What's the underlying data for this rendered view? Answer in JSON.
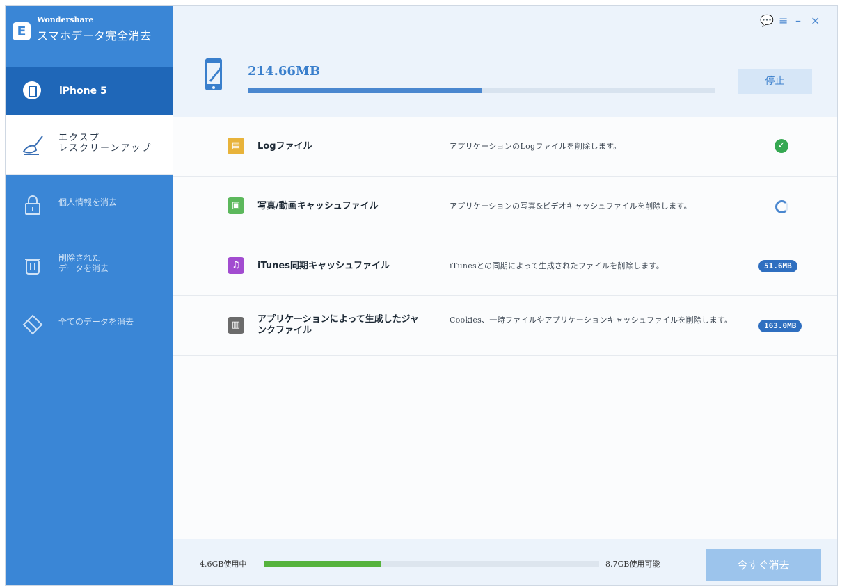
{
  "brand": {
    "company": "Wondershare",
    "title": "スマホデータ完全消去"
  },
  "device": {
    "name": "iPhone 5"
  },
  "sidebar": {
    "items": [
      {
        "label_line1": "エクスプ",
        "label_line2": "レスクリーンアップ",
        "active": true
      },
      {
        "label_line1": "個人情報を消去",
        "label_line2": "",
        "active": false
      },
      {
        "label_line1": "削除された",
        "label_line2": "データを消去",
        "active": false
      },
      {
        "label_line1": "全てのデータを消去",
        "label_line2": "",
        "active": false
      }
    ]
  },
  "window_controls": {
    "chat": "💬",
    "menu": "≡",
    "minimize": "–",
    "close": "×"
  },
  "scan": {
    "size": "214.66MB",
    "progress_fraction": 0.5,
    "stop_label": "停止"
  },
  "files": [
    {
      "name": "Logファイル",
      "description": "アプリケーションのLogファイルを削除します。",
      "status": "done",
      "icon_color": "#e8b33a",
      "icon_name": "log-file-icon",
      "glyph": "▤"
    },
    {
      "name": "写真/動画キャッシュファイル",
      "description": "アプリケーションの写真&ビデオキャッシュファイルを削除します。",
      "status": "loading",
      "icon_color": "#5cb85c",
      "icon_name": "photo-icon",
      "glyph": "▣"
    },
    {
      "name": "iTunes同期キャッシュファイル",
      "description": "iTunesとの同期によって生成されたファイルを削除します。",
      "status": "size",
      "size": "51.6MB",
      "icon_color": "#a24cd0",
      "icon_name": "music-icon",
      "glyph": "♫"
    },
    {
      "name": "アプリケーションによって生成したジャンクファイル",
      "description": "Cookies、一時ファイルやアプリケーションキャッシュファイルを削除します。",
      "status": "size",
      "size": "163.0MB",
      "icon_color": "#6b6b6b",
      "icon_name": "trash-icon",
      "glyph": "▥"
    }
  ],
  "storage": {
    "used": "4.6GB使用中",
    "available": "8.7GB使用可能",
    "used_fraction": 0.35
  },
  "erase_button": {
    "label": "今すぐ消去"
  },
  "colors": {
    "sidebar": "#3a86d6",
    "accent": "#3a7fcc",
    "storage_fill": "#56b33d",
    "check": "#35a852"
  }
}
